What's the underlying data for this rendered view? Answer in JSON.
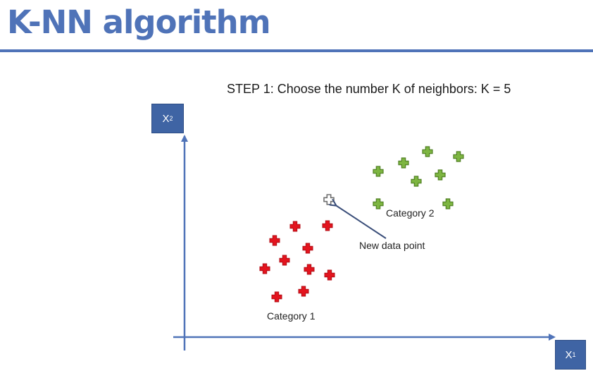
{
  "slide": {
    "title": "K-NN algorithm",
    "step_text": "STEP 1: Choose the number K of neighbors: K = 5"
  },
  "axes": {
    "x_label": {
      "letter": "X",
      "subscript": "1"
    },
    "y_label": {
      "letter": "X",
      "subscript": "2"
    },
    "color": "#4f73b8",
    "box_color": "#3f64a4"
  },
  "categories": [
    {
      "name": "Category 1",
      "color": "#e3141e",
      "marker": "plus-icon"
    },
    {
      "name": "Category 2",
      "color": "#7db541",
      "marker": "plus-icon"
    }
  ],
  "new_point": {
    "label": "New data point",
    "color": "#9a9a9a",
    "marker": "plus-icon"
  }
}
